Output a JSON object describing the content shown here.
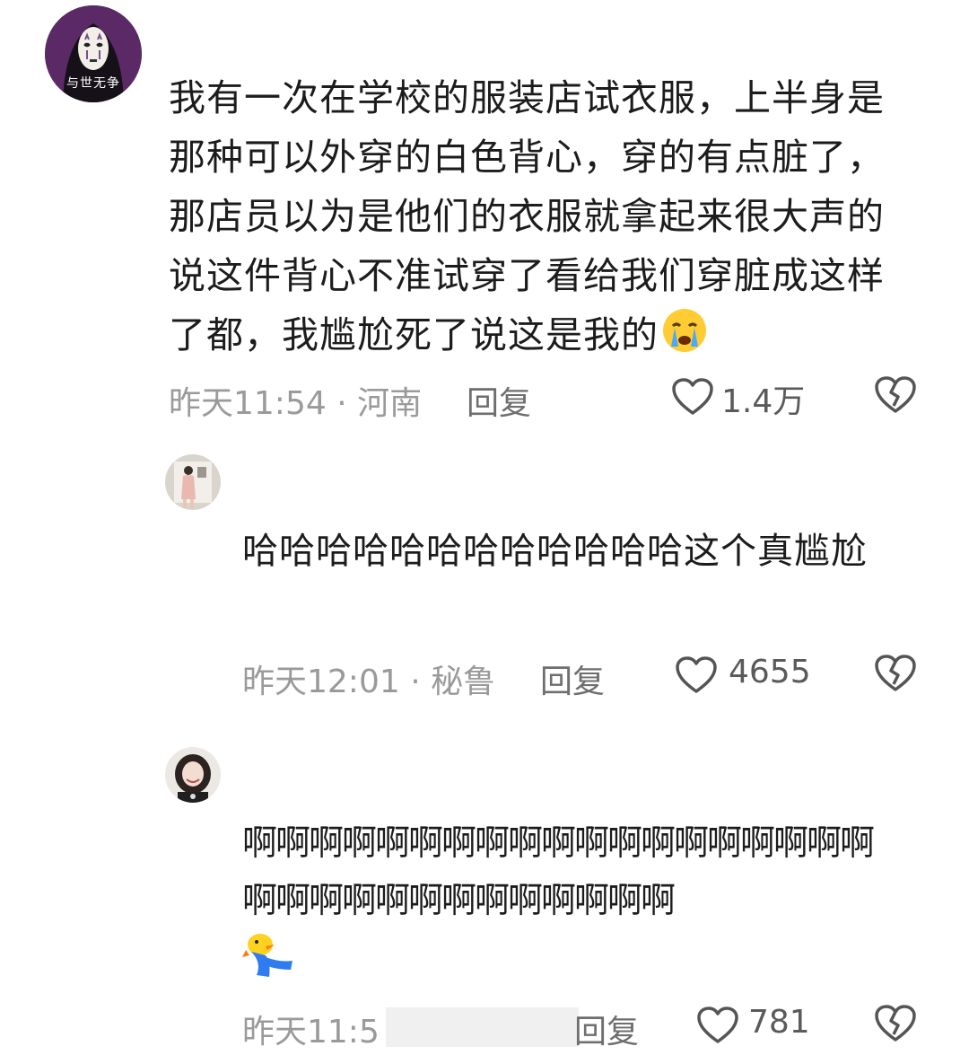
{
  "comments": [
    {
      "avatar_badge": "与世无争",
      "text": "我有一次在学校的服装店试衣服，上半身是那种可以外穿的白色背心，穿的有点脏了，那店员以为是他们的衣服就拿起来很大声的说这件背心不准试穿了看给我们穿脏成这样了都，我尴尬死了说这是我的",
      "emoji": "crying-face",
      "time": "昨天11:54",
      "separator": "·",
      "location": "河南",
      "reply_label": "回复",
      "likes": "1.4万"
    },
    {
      "text": "哈哈哈哈哈哈哈哈哈哈哈哈这个真尴尬",
      "time": "昨天12:01",
      "separator": "·",
      "location": "秘鲁",
      "reply_label": "回复",
      "likes": "4655"
    },
    {
      "text": "啊啊啊啊啊啊啊啊啊啊啊啊啊啊啊啊啊啊啊啊啊啊啊啊啊啊啊啊啊啊啊啊",
      "emoji": "falling-duck-sticker",
      "time": "昨天11:5",
      "reply_label": "回复",
      "likes": "781"
    }
  ],
  "icons": {
    "like": "heart-outline-icon",
    "dislike": "broken-heart-icon"
  }
}
